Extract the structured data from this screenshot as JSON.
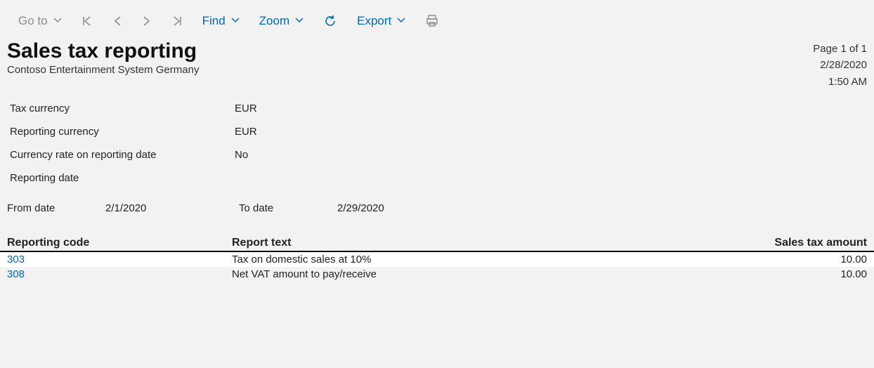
{
  "toolbar": {
    "goto_label": "Go to",
    "find_label": "Find",
    "zoom_label": "Zoom",
    "export_label": "Export"
  },
  "header": {
    "title": "Sales tax reporting",
    "company": "Contoso Entertainment System Germany",
    "page_label": "Page 1 of 1",
    "run_date": "2/28/2020",
    "run_time": "1:50 AM"
  },
  "params": {
    "tax_currency_label": "Tax currency",
    "tax_currency_value": "EUR",
    "reporting_currency_label": "Reporting currency",
    "reporting_currency_value": "EUR",
    "rate_on_date_label": "Currency rate on reporting date",
    "rate_on_date_value": "No",
    "reporting_date_label": "Reporting date",
    "reporting_date_value": ""
  },
  "daterange": {
    "from_label": "From date",
    "from_value": "2/1/2020",
    "to_label": "To date",
    "to_value": "2/29/2020"
  },
  "table": {
    "head_code": "Reporting code",
    "head_text": "Report text",
    "head_amount": "Sales tax amount",
    "rows": [
      {
        "code": "303",
        "text": "Tax on domestic sales at 10%",
        "amount": "10.00"
      },
      {
        "code": "308",
        "text": "Net VAT amount to pay/receive",
        "amount": "10.00"
      }
    ]
  }
}
